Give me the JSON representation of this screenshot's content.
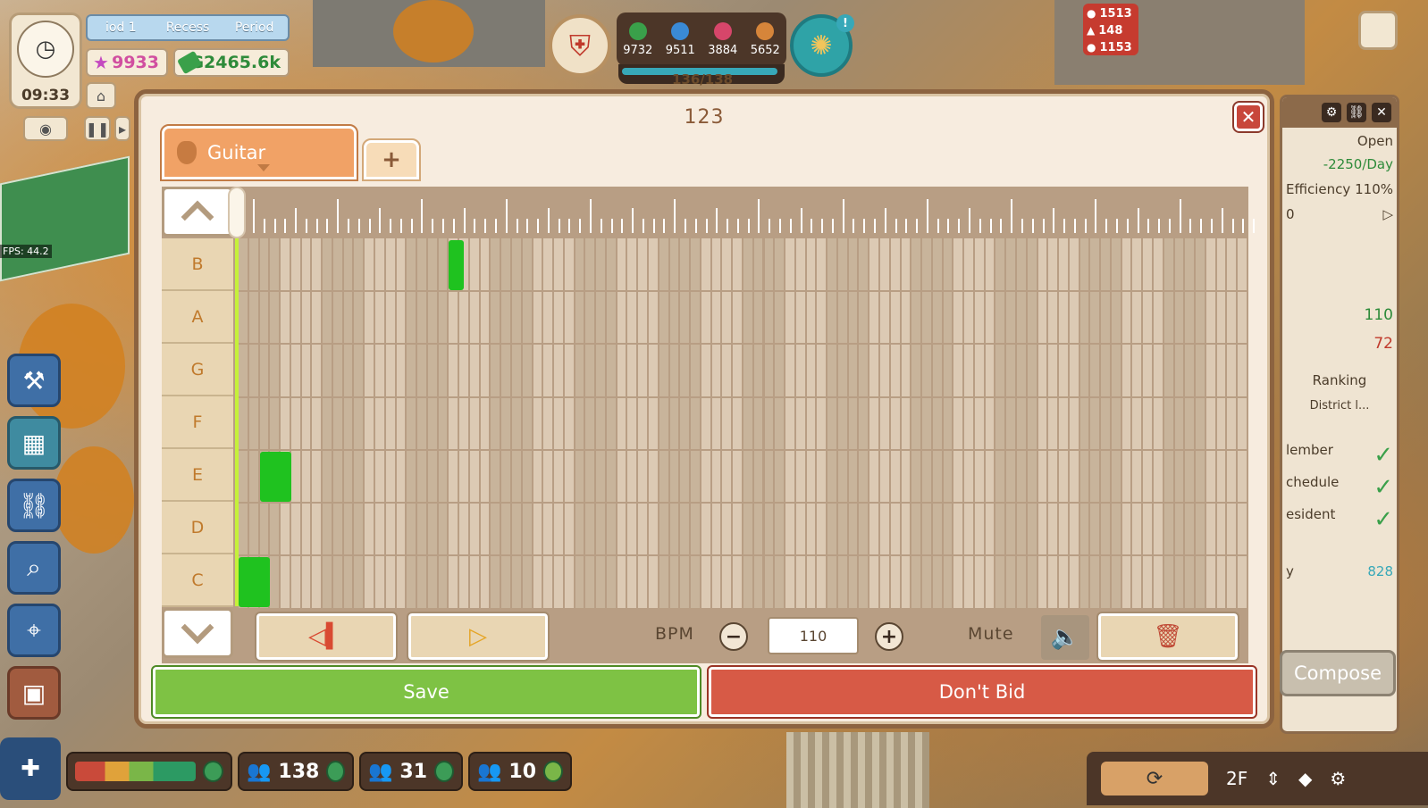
{
  "hud": {
    "clock_time": "09:33",
    "period_tabs": [
      "iod 1",
      "Recess",
      "Period"
    ],
    "stars": "9933",
    "money": "G2465.6k",
    "fps": "FPS: 44.2",
    "resources": [
      {
        "value": "9732",
        "color": "#3aa04a"
      },
      {
        "value": "9511",
        "color": "#3a8ad6"
      },
      {
        "value": "3884",
        "color": "#d6466a"
      },
      {
        "value": "5652",
        "color": "#d6853a"
      }
    ],
    "capacity": "136/138",
    "capacity_fraction": 0.98,
    "alerts": [
      "1513",
      "148",
      "1153"
    ]
  },
  "right_panel": {
    "status": "Open",
    "cost": "-2250/Day",
    "efficiency_label": "Efficiency",
    "efficiency_value": "110%",
    "slider_value": "0",
    "stat_green": "110",
    "stat_red": "72",
    "ranking_label": "Ranking",
    "ranking_value": "District l...",
    "checks": [
      "lember",
      "chedule",
      "esident"
    ],
    "coin_label": "y",
    "coin_value": "828",
    "compose_label": "Compose"
  },
  "bottom_bar": {
    "students": "138",
    "teachers": "31",
    "staff": "10",
    "floor": "2F"
  },
  "dialog": {
    "title": "123",
    "tab_label": "Guitar",
    "add_tab": "+",
    "notes_keys": [
      "B",
      "A",
      "G",
      "F",
      "E",
      "D",
      "C"
    ],
    "notes": [
      {
        "key": "B",
        "step": 20,
        "length": 1
      },
      {
        "key": "E",
        "step": 2,
        "length": 3
      },
      {
        "key": "C",
        "step": 0,
        "length": 3
      }
    ],
    "bpm_label": "BPM",
    "bpm_value": "110",
    "mute_label": "Mute",
    "save_label": "Save",
    "nobid_label": "Don't Bid"
  }
}
